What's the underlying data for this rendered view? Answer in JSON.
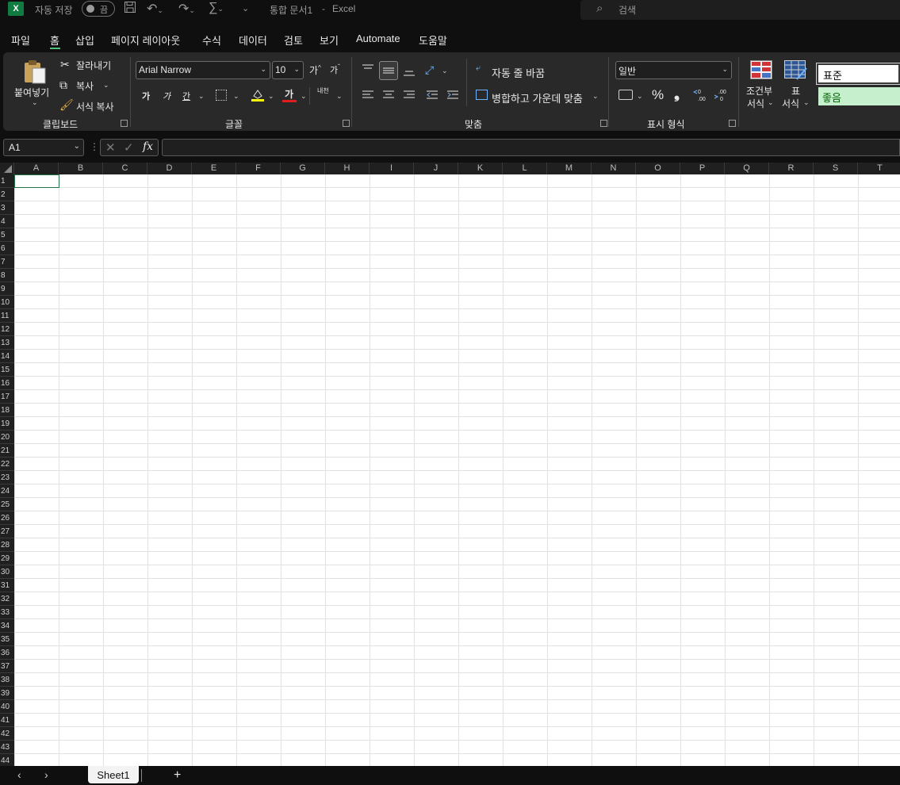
{
  "titlebar": {
    "autosave_label": "자동 저장",
    "autosave_state": "끔",
    "doc_title": "통합 문서1",
    "separator": "-",
    "app_name": "Excel",
    "search_placeholder": "검색"
  },
  "menu": {
    "tabs": [
      "파일",
      "홈",
      "삽입",
      "페이지 레이아웃",
      "수식",
      "데이터",
      "검토",
      "보기",
      "Automate",
      "도움말"
    ],
    "active_tab": "홈"
  },
  "ribbon": {
    "clipboard": {
      "paste": "붙여넣기",
      "cut": "잘라내기",
      "copy": "복사",
      "format_painter": "서식 복사",
      "label": "클립보드"
    },
    "font": {
      "font_name": "Arial Narrow",
      "font_size": "10",
      "grow": "가",
      "shrink": "가",
      "bold": "가",
      "italic": "가",
      "underline": "간",
      "font_color": "가",
      "phonetic": "내천",
      "label": "글꼴"
    },
    "alignment": {
      "wrap_text": "자동 줄 바꿈",
      "merge_center": "병합하고 가운데 맞춤",
      "label": "맞춤"
    },
    "number": {
      "format": "일반",
      "percent": "%",
      "comma": "❟",
      "label": "표시 형식"
    },
    "styles": {
      "conditional_line1": "조건부",
      "conditional_line2": "서식",
      "table_line1": "표",
      "table_line2": "서식",
      "style_normal": "표준",
      "style_good": "좋음"
    }
  },
  "formula_bar": {
    "name_box": "A1",
    "fx": "fx",
    "formula": ""
  },
  "grid": {
    "columns": [
      "A",
      "B",
      "C",
      "D",
      "E",
      "F",
      "G",
      "H",
      "I",
      "J",
      "K",
      "L",
      "M",
      "N",
      "O",
      "P",
      "Q",
      "R",
      "S",
      "T"
    ],
    "rows": [
      "1",
      "2",
      "3",
      "4",
      "5",
      "6",
      "7",
      "8",
      "9",
      "10",
      "11",
      "12",
      "13",
      "14",
      "15",
      "16",
      "17",
      "18",
      "19",
      "20",
      "21",
      "22",
      "23",
      "24",
      "25",
      "26",
      "27",
      "28",
      "29",
      "30",
      "31",
      "32",
      "33",
      "34",
      "35",
      "36",
      "37",
      "38",
      "39",
      "40",
      "41",
      "42",
      "43",
      "44"
    ]
  },
  "sheets": {
    "tabs": [
      "Sheet1"
    ],
    "add": "+"
  }
}
